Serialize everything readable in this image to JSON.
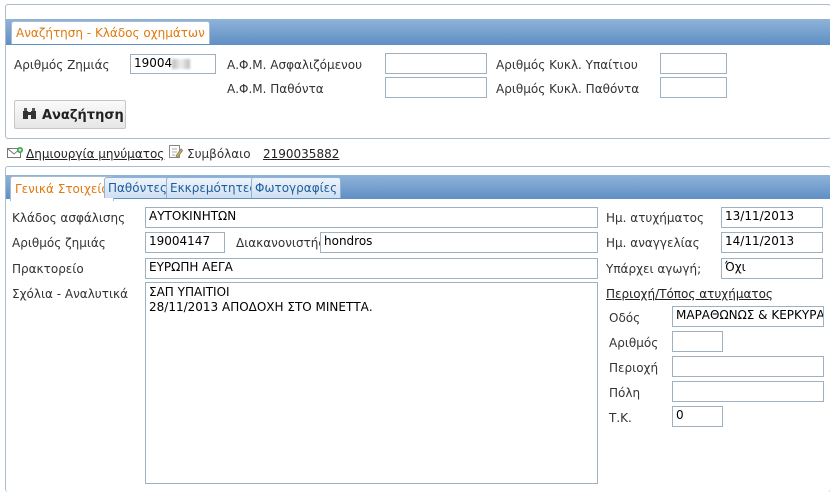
{
  "search": {
    "tab_label": "Αναζήτηση - Κλάδος οχημάτων",
    "claim_label": "Αριθμός Ζημιάς",
    "claim_value": "19004",
    "afm_insured_label": "Α.Φ.Μ. Ασφαλιζόμενου",
    "afm_injured_label": "Α.Φ.Μ. Παθόντα",
    "cc_liable_label": "Αριθμός Κυκλ. Υπαίτιου",
    "cc_injured_label": "Αριθμός Κυκλ. Παθόντα",
    "search_button": "Αναζήτηση"
  },
  "toolbar": {
    "create_message": "Δημιουργία μηνύματος",
    "contract_label": "Συμβόλαιο",
    "contract_number": "2190035882"
  },
  "tabs": [
    "Γενικά Στοιχεία",
    "Παθόντες",
    "Εκκρεμότητες",
    "Φωτογραφίες"
  ],
  "general": {
    "branch_label": "Κλάδος ασφάλισης",
    "branch_value": "ΑΥΤΟΚΙΝΗΤΩΝ",
    "claim_label": "Αριθμός ζημιάς",
    "claim_value": "19004147",
    "handler_label": "Διακανονιστής",
    "handler_value": "hondros",
    "agency_label": "Πρακτορείο",
    "agency_value": "ΕΥΡΩΠΗ ΑΕΓΑ",
    "comments_label": "Σχόλια - Αναλυτικά",
    "comments_value": "ΣΑΠ ΥΠΑΙΤΙΟΙ\n28/11/2013 ΑΠΟΔΟΧΗ ΣΤΟ ΜΙΝΕΤΤΑ.",
    "accident_date_label": "Ημ. ατυχήματος",
    "accident_date": "13/11/2013",
    "report_date_label": "Ημ. αναγγελίας",
    "report_date": "14/11/2013",
    "lawsuit_label": "Υπάρχει αγωγή;",
    "lawsuit_value": "Όχι",
    "location_heading": "Περιοχή/Τόπος ατυχήματος",
    "street_label": "Οδός",
    "street_value": "ΜΑΡΑΘΩΝΩΣ &  ΚΕΡΚΥΡΑΣ",
    "number_label": "Αριθμός",
    "area_label": "Περιοχή",
    "city_label": "Πόλη",
    "postal_label": "Τ.Κ.",
    "postal_value": "0"
  },
  "icons": [
    "envelope-add-icon",
    "contract-edit-icon",
    "binoculars-icon"
  ]
}
